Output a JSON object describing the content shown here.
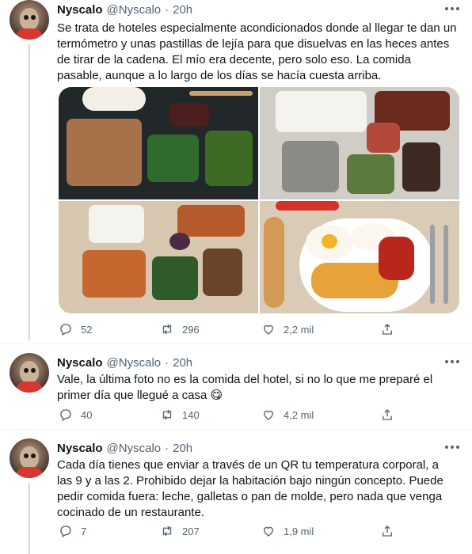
{
  "tweets": [
    {
      "name": "Nyscalo",
      "handle": "@Nyscalo",
      "dot": "·",
      "time": "20h",
      "text": "Se trata de hoteles especialmente acondicionados donde al llegar te dan un termómetro y unas pastillas de lejía para que disuelvas en las heces antes de tirar de la cadena. El mío era decente, pero solo eso. La comida pasable, aunque a lo largo de los días se hacía cuesta arriba.",
      "replies": "52",
      "retweets": "296",
      "likes": "2,2 mil"
    },
    {
      "name": "Nyscalo",
      "handle": "@Nyscalo",
      "dot": "·",
      "time": "20h",
      "text": "Vale, la última foto no es la comida del hotel, si no lo que me preparé el primer día que llegué a casa 😋",
      "replies": "40",
      "retweets": "140",
      "likes": "4,2 mil"
    },
    {
      "name": "Nyscalo",
      "handle": "@Nyscalo",
      "dot": "·",
      "time": "20h",
      "text": "Cada día tienes que enviar a través de un QR tu temperatura corporal, a las 9 y a las 2. Prohibido dejar la habitación bajo ningún concepto. Puede pedir comida fuera: leche, galletas o pan de molde, pero nada que venga cocinado de un restaurante.",
      "replies": "7",
      "retweets": "207",
      "likes": "1,9 mil"
    }
  ],
  "icons": {
    "reply": "reply-icon",
    "retweet": "retweet-icon",
    "like": "heart-icon",
    "share": "share-icon",
    "more": "more-icon"
  },
  "colors": {
    "text": "#0f1419",
    "secondary": "#536471",
    "thread_line": "#cfd9de"
  }
}
